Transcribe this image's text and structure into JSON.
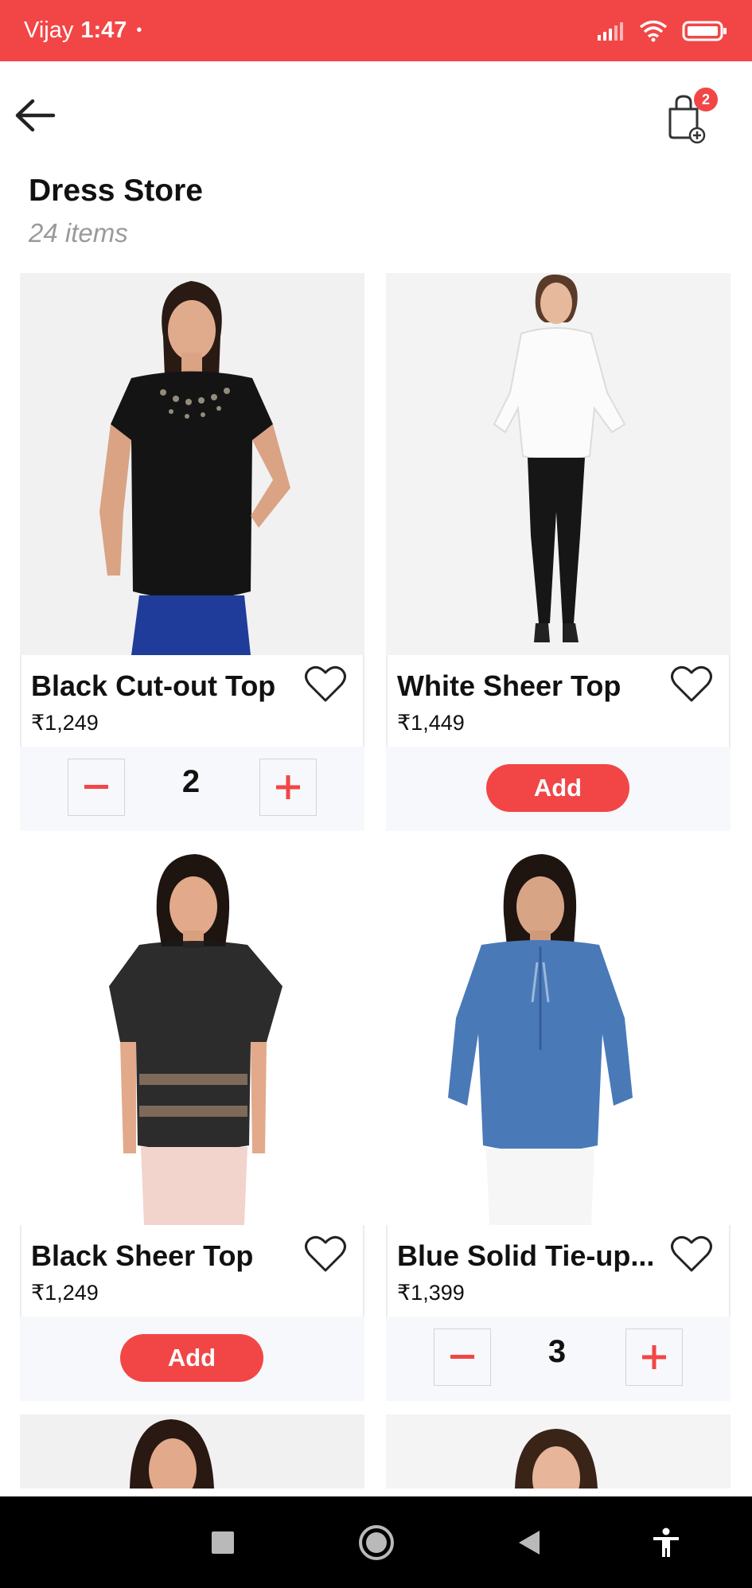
{
  "status_bar": {
    "carrier": "Vijay",
    "time": "1:47",
    "dot": "•"
  },
  "header": {
    "cart_badge": "2"
  },
  "store": {
    "title": "Dress Store",
    "item_count": "24 items"
  },
  "products": [
    {
      "name": "Black Cut-out Top",
      "price": "₹1,249",
      "quantity": "2",
      "action": "stepper"
    },
    {
      "name": "White Sheer Top",
      "price": "₹1,449",
      "add_label": "Add",
      "action": "add"
    },
    {
      "name": "Black Sheer Top",
      "price": "₹1,249",
      "add_label": "Add",
      "action": "add"
    },
    {
      "name": "Blue Solid Tie-up...",
      "price": "₹1,399",
      "quantity": "3",
      "action": "stepper"
    }
  ],
  "colors": {
    "accent": "#f24646",
    "background": "#ffffff",
    "card_action_bg": "#f7f8fb",
    "muted_text": "#9a9a9a"
  },
  "icons": {
    "back": "arrow-left-icon",
    "cart": "shopping-bag-icon",
    "favorite": "heart-outline-icon",
    "nav_recent": "square-icon",
    "nav_home": "circle-icon",
    "nav_back": "triangle-back-icon",
    "nav_accessibility": "accessibility-icon"
  }
}
